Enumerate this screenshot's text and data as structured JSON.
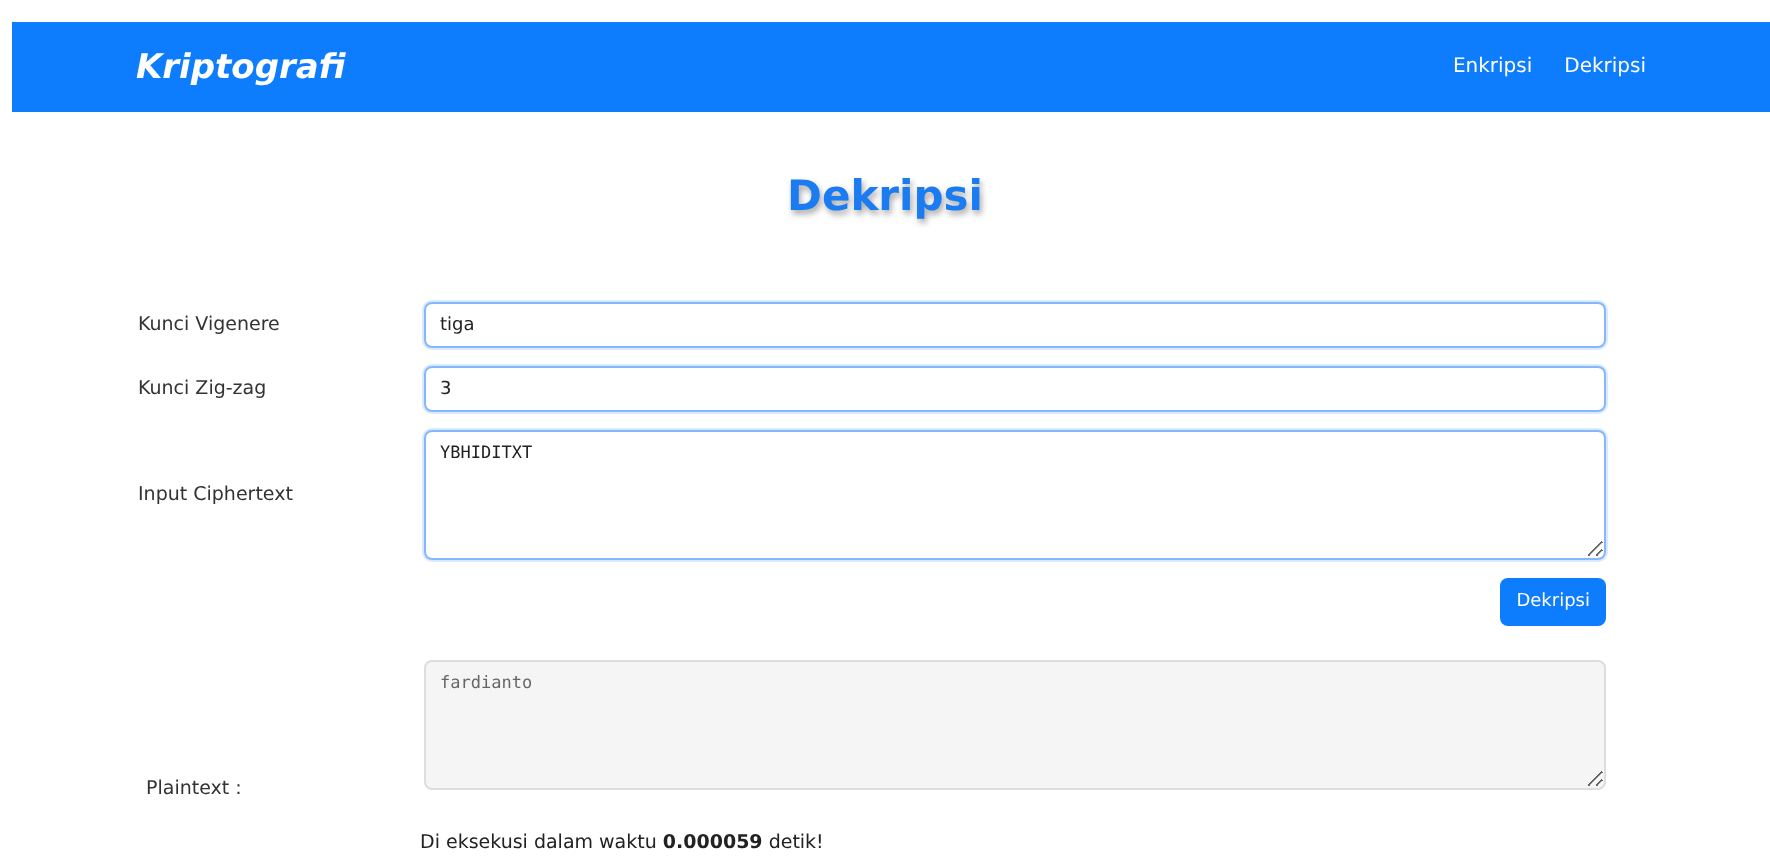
{
  "navbar": {
    "brand": "Kriptografi",
    "links": [
      {
        "label": "Enkripsi"
      },
      {
        "label": "Dekripsi"
      }
    ]
  },
  "heading": "Dekripsi",
  "fields": [
    {
      "label": "Kunci Vigenere",
      "kind": "input",
      "value": "tiga"
    },
    {
      "label": "Kunci Zig-zag",
      "kind": "input",
      "value": "3"
    },
    {
      "label": "Input Ciphertext",
      "kind": "textarea",
      "value": "YBHIDITXT"
    }
  ],
  "submit_button": "Dekripsi",
  "output": {
    "label": "Plaintext :",
    "value": "fardianto",
    "readonly": true
  },
  "result_message": "Di eksekusi dalam waktu **0.000059** detik!"
}
